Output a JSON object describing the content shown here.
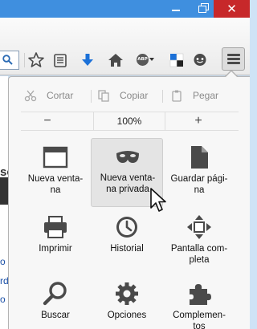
{
  "window": {
    "close_glyph": "✕",
    "accent_color": "#3f8fdf",
    "close_color": "#c7282a"
  },
  "toolbar": {
    "icons": [
      "search-icon",
      "bookmark-star-icon",
      "reading-list-icon",
      "download-icon",
      "home-icon",
      "adblock-plus-icon",
      "screenshot-icon",
      "chat-icon",
      "hamburger-menu-icon"
    ],
    "abp_label": "ABP"
  },
  "page_left": {
    "chars": [
      "sc",
      "o",
      "rd",
      "o"
    ]
  },
  "menu": {
    "edit": {
      "cut_label": "Cortar",
      "copy_label": "Copiar",
      "paste_label": "Pegar"
    },
    "zoom": {
      "minus_label": "−",
      "value": "100%",
      "plus_label": "+"
    },
    "items": [
      {
        "label": "Nueva venta-\nna",
        "icon": "new-window-icon"
      },
      {
        "label": "Nueva venta-\nna privada",
        "icon": "private-mask-icon"
      },
      {
        "label": "Guardar pági-\nna",
        "icon": "save-page-icon"
      },
      {
        "label": "Imprimir",
        "icon": "print-icon"
      },
      {
        "label": "Historial",
        "icon": "history-icon"
      },
      {
        "label": "Pantalla com-\npleta",
        "icon": "fullscreen-icon"
      },
      {
        "label": "Buscar",
        "icon": "search-icon"
      },
      {
        "label": "Opciones",
        "icon": "gear-icon"
      },
      {
        "label": "Complemen-\ntos",
        "icon": "puzzle-icon"
      }
    ]
  }
}
